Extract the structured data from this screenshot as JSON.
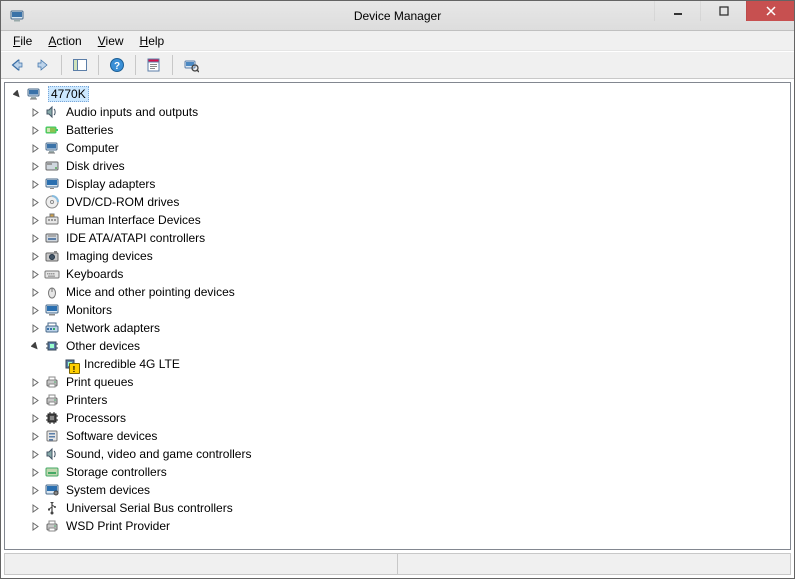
{
  "window": {
    "title": "Device Manager"
  },
  "menubar": {
    "file": "File",
    "action": "Action",
    "view": "View",
    "help": "Help"
  },
  "toolbar": {
    "back": "Back",
    "forward": "Forward",
    "show_hide_tree": "Show/Hide Console Tree",
    "help": "Help",
    "properties": "Properties",
    "scan": "Scan for hardware changes"
  },
  "tree": {
    "root": {
      "label": "4770K",
      "expanded": true,
      "selected": true,
      "icon": "computer"
    },
    "nodes": [
      {
        "label": "Audio inputs and outputs",
        "icon": "speaker",
        "expanded": false
      },
      {
        "label": "Batteries",
        "icon": "battery",
        "expanded": false
      },
      {
        "label": "Computer",
        "icon": "computer",
        "expanded": false
      },
      {
        "label": "Disk drives",
        "icon": "disk",
        "expanded": false
      },
      {
        "label": "Display adapters",
        "icon": "display",
        "expanded": false
      },
      {
        "label": "DVD/CD-ROM drives",
        "icon": "cd",
        "expanded": false
      },
      {
        "label": "Human Interface Devices",
        "icon": "hid",
        "expanded": false
      },
      {
        "label": "IDE ATA/ATAPI controllers",
        "icon": "ide",
        "expanded": false
      },
      {
        "label": "Imaging devices",
        "icon": "camera",
        "expanded": false
      },
      {
        "label": "Keyboards",
        "icon": "keyboard",
        "expanded": false
      },
      {
        "label": "Mice and other pointing devices",
        "icon": "mouse",
        "expanded": false
      },
      {
        "label": "Monitors",
        "icon": "monitor",
        "expanded": false
      },
      {
        "label": "Network adapters",
        "icon": "network",
        "expanded": false
      },
      {
        "label": "Other devices",
        "icon": "chip",
        "expanded": true,
        "children": [
          {
            "label": "Incredible 4G LTE",
            "icon": "chip-warn",
            "expanded": null
          }
        ]
      },
      {
        "label": "Print queues",
        "icon": "printer",
        "expanded": false
      },
      {
        "label": "Printers",
        "icon": "printer",
        "expanded": false
      },
      {
        "label": "Processors",
        "icon": "cpu",
        "expanded": false
      },
      {
        "label": "Software devices",
        "icon": "software",
        "expanded": false
      },
      {
        "label": "Sound, video and game controllers",
        "icon": "speaker",
        "expanded": false
      },
      {
        "label": "Storage controllers",
        "icon": "storage",
        "expanded": false
      },
      {
        "label": "System devices",
        "icon": "system",
        "expanded": false
      },
      {
        "label": "Universal Serial Bus controllers",
        "icon": "usb",
        "expanded": false
      },
      {
        "label": "WSD Print Provider",
        "icon": "printer",
        "expanded": false
      }
    ]
  }
}
